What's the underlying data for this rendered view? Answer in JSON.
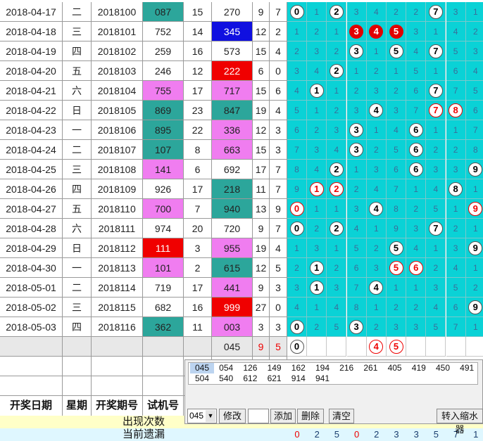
{
  "rows": [
    {
      "date": "2018-04-17",
      "week": "二",
      "issue": "2018100",
      "trial": "087",
      "trial_style": "teal",
      "span": "15",
      "draw": "270",
      "draw_style": "",
      "sum": "9",
      "tail": "7",
      "digits": [
        {
          "t": "0",
          "s": "w"
        },
        {
          "t": "1",
          "s": ""
        },
        {
          "t": "2",
          "s": "w"
        },
        {
          "t": "3",
          "s": ""
        },
        {
          "t": "4",
          "s": ""
        },
        {
          "t": "2",
          "s": ""
        },
        {
          "t": "2",
          "s": ""
        },
        {
          "t": "7",
          "s": "w"
        },
        {
          "t": "3",
          "s": ""
        },
        {
          "t": "1",
          "s": ""
        }
      ]
    },
    {
      "date": "2018-04-18",
      "week": "三",
      "issue": "2018101",
      "trial": "752",
      "trial_style": "",
      "span": "14",
      "draw": "345",
      "draw_style": "blue",
      "sum": "12",
      "tail": "2",
      "digits": [
        {
          "t": "1",
          "s": ""
        },
        {
          "t": "2",
          "s": ""
        },
        {
          "t": "1",
          "s": ""
        },
        {
          "t": "3",
          "s": "f"
        },
        {
          "t": "4",
          "s": "f"
        },
        {
          "t": "5",
          "s": "f"
        },
        {
          "t": "3",
          "s": ""
        },
        {
          "t": "1",
          "s": ""
        },
        {
          "t": "4",
          "s": ""
        },
        {
          "t": "2",
          "s": ""
        }
      ]
    },
    {
      "date": "2018-04-19",
      "week": "四",
      "issue": "2018102",
      "trial": "259",
      "trial_style": "",
      "span": "16",
      "draw": "573",
      "draw_style": "",
      "sum": "15",
      "tail": "4",
      "digits": [
        {
          "t": "2",
          "s": ""
        },
        {
          "t": "3",
          "s": ""
        },
        {
          "t": "2",
          "s": ""
        },
        {
          "t": "3",
          "s": "w"
        },
        {
          "t": "1",
          "s": ""
        },
        {
          "t": "5",
          "s": "w"
        },
        {
          "t": "4",
          "s": ""
        },
        {
          "t": "7",
          "s": "w"
        },
        {
          "t": "5",
          "s": ""
        },
        {
          "t": "3",
          "s": ""
        }
      ]
    },
    {
      "date": "2018-04-20",
      "week": "五",
      "issue": "2018103",
      "trial": "246",
      "trial_style": "",
      "span": "12",
      "draw": "222",
      "draw_style": "red",
      "sum": "6",
      "tail": "0",
      "digits": [
        {
          "t": "3",
          "s": ""
        },
        {
          "t": "4",
          "s": ""
        },
        {
          "t": "2",
          "s": "w"
        },
        {
          "t": "1",
          "s": ""
        },
        {
          "t": "2",
          "s": ""
        },
        {
          "t": "1",
          "s": ""
        },
        {
          "t": "5",
          "s": ""
        },
        {
          "t": "1",
          "s": ""
        },
        {
          "t": "6",
          "s": ""
        },
        {
          "t": "4",
          "s": ""
        }
      ]
    },
    {
      "date": "2018-04-21",
      "week": "六",
      "issue": "2018104",
      "trial": "755",
      "trial_style": "pink",
      "span": "17",
      "draw": "717",
      "draw_style": "pink",
      "sum": "15",
      "tail": "6",
      "digits": [
        {
          "t": "4",
          "s": ""
        },
        {
          "t": "1",
          "s": "w"
        },
        {
          "t": "1",
          "s": ""
        },
        {
          "t": "2",
          "s": ""
        },
        {
          "t": "3",
          "s": ""
        },
        {
          "t": "2",
          "s": ""
        },
        {
          "t": "6",
          "s": ""
        },
        {
          "t": "7",
          "s": "w"
        },
        {
          "t": "7",
          "s": ""
        },
        {
          "t": "5",
          "s": ""
        }
      ]
    },
    {
      "date": "2018-04-22",
      "week": "日",
      "issue": "2018105",
      "trial": "869",
      "trial_style": "teal",
      "span": "23",
      "draw": "847",
      "draw_style": "teal",
      "sum": "19",
      "tail": "4",
      "digits": [
        {
          "t": "5",
          "s": ""
        },
        {
          "t": "1",
          "s": ""
        },
        {
          "t": "2",
          "s": ""
        },
        {
          "t": "3",
          "s": ""
        },
        {
          "t": "4",
          "s": "w"
        },
        {
          "t": "3",
          "s": ""
        },
        {
          "t": "7",
          "s": ""
        },
        {
          "t": "7",
          "s": "r"
        },
        {
          "t": "8",
          "s": "r"
        },
        {
          "t": "6",
          "s": ""
        }
      ]
    },
    {
      "date": "2018-04-23",
      "week": "一",
      "issue": "2018106",
      "trial": "895",
      "trial_style": "teal",
      "span": "22",
      "draw": "336",
      "draw_style": "pink",
      "sum": "12",
      "tail": "3",
      "digits": [
        {
          "t": "6",
          "s": ""
        },
        {
          "t": "2",
          "s": ""
        },
        {
          "t": "3",
          "s": ""
        },
        {
          "t": "3",
          "s": "w"
        },
        {
          "t": "1",
          "s": ""
        },
        {
          "t": "4",
          "s": ""
        },
        {
          "t": "6",
          "s": "w"
        },
        {
          "t": "1",
          "s": ""
        },
        {
          "t": "1",
          "s": ""
        },
        {
          "t": "7",
          "s": ""
        }
      ]
    },
    {
      "date": "2018-04-24",
      "week": "二",
      "issue": "2018107",
      "trial": "107",
      "trial_style": "teal",
      "span": "8",
      "draw": "663",
      "draw_style": "pink",
      "sum": "15",
      "tail": "3",
      "digits": [
        {
          "t": "7",
          "s": ""
        },
        {
          "t": "3",
          "s": ""
        },
        {
          "t": "4",
          "s": ""
        },
        {
          "t": "3",
          "s": "w"
        },
        {
          "t": "2",
          "s": ""
        },
        {
          "t": "5",
          "s": ""
        },
        {
          "t": "6",
          "s": "w"
        },
        {
          "t": "2",
          "s": ""
        },
        {
          "t": "2",
          "s": ""
        },
        {
          "t": "8",
          "s": ""
        }
      ]
    },
    {
      "date": "2018-04-25",
      "week": "三",
      "issue": "2018108",
      "trial": "141",
      "trial_style": "pink",
      "span": "6",
      "draw": "692",
      "draw_style": "",
      "sum": "17",
      "tail": "7",
      "digits": [
        {
          "t": "8",
          "s": ""
        },
        {
          "t": "4",
          "s": ""
        },
        {
          "t": "2",
          "s": "w"
        },
        {
          "t": "1",
          "s": ""
        },
        {
          "t": "3",
          "s": ""
        },
        {
          "t": "6",
          "s": ""
        },
        {
          "t": "6",
          "s": "w"
        },
        {
          "t": "3",
          "s": ""
        },
        {
          "t": "3",
          "s": ""
        },
        {
          "t": "9",
          "s": "w"
        }
      ]
    },
    {
      "date": "2018-04-26",
      "week": "四",
      "issue": "2018109",
      "trial": "926",
      "trial_style": "",
      "span": "17",
      "draw": "218",
      "draw_style": "teal",
      "sum": "11",
      "tail": "7",
      "digits": [
        {
          "t": "9",
          "s": ""
        },
        {
          "t": "1",
          "s": "r"
        },
        {
          "t": "2",
          "s": "r"
        },
        {
          "t": "2",
          "s": ""
        },
        {
          "t": "4",
          "s": ""
        },
        {
          "t": "7",
          "s": ""
        },
        {
          "t": "1",
          "s": ""
        },
        {
          "t": "4",
          "s": ""
        },
        {
          "t": "8",
          "s": "w"
        },
        {
          "t": "1",
          "s": ""
        }
      ]
    },
    {
      "date": "2018-04-27",
      "week": "五",
      "issue": "2018110",
      "trial": "700",
      "trial_style": "pink",
      "span": "7",
      "draw": "940",
      "draw_style": "teal",
      "sum": "13",
      "tail": "9",
      "digits": [
        {
          "t": "0",
          "s": "r"
        },
        {
          "t": "1",
          "s": ""
        },
        {
          "t": "1",
          "s": ""
        },
        {
          "t": "3",
          "s": ""
        },
        {
          "t": "4",
          "s": "w"
        },
        {
          "t": "8",
          "s": ""
        },
        {
          "t": "2",
          "s": ""
        },
        {
          "t": "5",
          "s": ""
        },
        {
          "t": "1",
          "s": ""
        },
        {
          "t": "9",
          "s": "r"
        }
      ]
    },
    {
      "date": "2018-04-28",
      "week": "六",
      "issue": "2018111",
      "trial": "974",
      "trial_style": "",
      "span": "20",
      "draw": "720",
      "draw_style": "",
      "sum": "9",
      "tail": "7",
      "digits": [
        {
          "t": "0",
          "s": "w"
        },
        {
          "t": "2",
          "s": ""
        },
        {
          "t": "2",
          "s": "w"
        },
        {
          "t": "4",
          "s": ""
        },
        {
          "t": "1",
          "s": ""
        },
        {
          "t": "9",
          "s": ""
        },
        {
          "t": "3",
          "s": ""
        },
        {
          "t": "7",
          "s": "w"
        },
        {
          "t": "2",
          "s": ""
        },
        {
          "t": "1",
          "s": ""
        }
      ]
    },
    {
      "date": "2018-04-29",
      "week": "日",
      "issue": "2018112",
      "trial": "111",
      "trial_style": "red",
      "span": "3",
      "draw": "955",
      "draw_style": "pink",
      "sum": "19",
      "tail": "4",
      "digits": [
        {
          "t": "1",
          "s": ""
        },
        {
          "t": "3",
          "s": ""
        },
        {
          "t": "1",
          "s": ""
        },
        {
          "t": "5",
          "s": ""
        },
        {
          "t": "2",
          "s": ""
        },
        {
          "t": "5",
          "s": "w"
        },
        {
          "t": "4",
          "s": ""
        },
        {
          "t": "1",
          "s": ""
        },
        {
          "t": "3",
          "s": ""
        },
        {
          "t": "9",
          "s": "w"
        }
      ]
    },
    {
      "date": "2018-04-30",
      "week": "一",
      "issue": "2018113",
      "trial": "101",
      "trial_style": "pink",
      "span": "2",
      "draw": "615",
      "draw_style": "teal",
      "sum": "12",
      "tail": "5",
      "digits": [
        {
          "t": "2",
          "s": ""
        },
        {
          "t": "1",
          "s": "w"
        },
        {
          "t": "2",
          "s": ""
        },
        {
          "t": "6",
          "s": ""
        },
        {
          "t": "3",
          "s": ""
        },
        {
          "t": "5",
          "s": "r"
        },
        {
          "t": "6",
          "s": "r"
        },
        {
          "t": "2",
          "s": ""
        },
        {
          "t": "4",
          "s": ""
        },
        {
          "t": "1",
          "s": ""
        }
      ]
    },
    {
      "date": "2018-05-01",
      "week": "二",
      "issue": "2018114",
      "trial": "719",
      "trial_style": "",
      "span": "17",
      "draw": "441",
      "draw_style": "pink",
      "sum": "9",
      "tail": "3",
      "digits": [
        {
          "t": "3",
          "s": ""
        },
        {
          "t": "1",
          "s": "w"
        },
        {
          "t": "3",
          "s": ""
        },
        {
          "t": "7",
          "s": ""
        },
        {
          "t": "4",
          "s": "w"
        },
        {
          "t": "1",
          "s": ""
        },
        {
          "t": "1",
          "s": ""
        },
        {
          "t": "3",
          "s": ""
        },
        {
          "t": "5",
          "s": ""
        },
        {
          "t": "2",
          "s": ""
        }
      ]
    },
    {
      "date": "2018-05-02",
      "week": "三",
      "issue": "2018115",
      "trial": "682",
      "trial_style": "",
      "span": "16",
      "draw": "999",
      "draw_style": "red",
      "sum": "27",
      "tail": "0",
      "digits": [
        {
          "t": "4",
          "s": ""
        },
        {
          "t": "1",
          "s": ""
        },
        {
          "t": "4",
          "s": ""
        },
        {
          "t": "8",
          "s": ""
        },
        {
          "t": "1",
          "s": ""
        },
        {
          "t": "2",
          "s": ""
        },
        {
          "t": "2",
          "s": ""
        },
        {
          "t": "4",
          "s": ""
        },
        {
          "t": "6",
          "s": ""
        },
        {
          "t": "9",
          "s": "w"
        }
      ]
    },
    {
      "date": "2018-05-03",
      "week": "四",
      "issue": "2018116",
      "trial": "362",
      "trial_style": "teal",
      "span": "11",
      "draw": "003",
      "draw_style": "pink",
      "sum": "3",
      "tail": "3",
      "digits": [
        {
          "t": "0",
          "s": "w"
        },
        {
          "t": "2",
          "s": ""
        },
        {
          "t": "5",
          "s": ""
        },
        {
          "t": "3",
          "s": "w"
        },
        {
          "t": "2",
          "s": ""
        },
        {
          "t": "3",
          "s": ""
        },
        {
          "t": "3",
          "s": ""
        },
        {
          "t": "5",
          "s": ""
        },
        {
          "t": "7",
          "s": ""
        },
        {
          "t": "1",
          "s": ""
        }
      ]
    }
  ],
  "forecast": {
    "draw": "045",
    "sum": "9",
    "tail": "5",
    "digits": [
      {
        "t": "0",
        "s": "w"
      },
      {
        "t": "",
        "s": ""
      },
      {
        "t": "",
        "s": ""
      },
      {
        "t": "",
        "s": ""
      },
      {
        "t": "4",
        "s": "r"
      },
      {
        "t": "5",
        "s": "r"
      },
      {
        "t": "",
        "s": ""
      },
      {
        "t": "",
        "s": ""
      },
      {
        "t": "",
        "s": ""
      },
      {
        "t": "",
        "s": ""
      }
    ]
  },
  "headers": {
    "date": "开奖日期",
    "week": "星期",
    "issue": "开奖期号",
    "trial": "试机号"
  },
  "stats": {
    "appear_label": "出现次数",
    "miss_label": "当前遗漏",
    "miss_values": [
      "0",
      "2",
      "5",
      "0",
      "2",
      "3",
      "3",
      "5",
      "7",
      "1"
    ]
  },
  "popup": {
    "tags_row1": [
      "045",
      "054",
      "126",
      "149",
      "162",
      "194",
      "216",
      "261",
      "405",
      "419",
      "450",
      "491"
    ],
    "tags_row2": [
      "504",
      "540",
      "612",
      "621",
      "914",
      "941"
    ],
    "select_value": "045",
    "btn_modify": "修改",
    "btn_add": "添加",
    "btn_delete": "删除",
    "btn_clear": "清空",
    "btn_shrink": "转入缩水器"
  }
}
